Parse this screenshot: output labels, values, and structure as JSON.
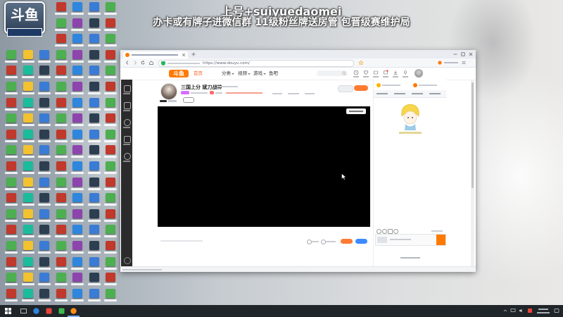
{
  "overlay": {
    "line1": "上号+suiyuedaomei",
    "line2": "办卡或有牌子进微信群 11级粉丝牌送房管  包晋级赛维护局"
  },
  "desktop_logo": "斗鱼",
  "desktop": {
    "icon_colors": [
      "#e8453c",
      "#3a7bd5",
      "#f2c230",
      "#4caf50",
      "#f5f5f5",
      "#8e44ad",
      "#ff8c1a",
      "#2c3e50",
      "#1abc9c",
      "#c0392b",
      "#5d6d7e",
      "#2e86de"
    ]
  },
  "browser": {
    "url": "https://www.douyu.com/"
  },
  "site": {
    "logo": "斗鱼",
    "nav": [
      {
        "label": "首页"
      },
      {
        "label": "分类"
      },
      {
        "label": "视频"
      },
      {
        "label": "游戏"
      },
      {
        "label": "鱼吧"
      }
    ]
  },
  "stream": {
    "title": "三国上分 斌刀战神"
  },
  "colors": {
    "accent": "#ff7a00",
    "video_bg": "#000000",
    "taskbar": "#1f2529",
    "secondary_button": "#3d8bff"
  }
}
